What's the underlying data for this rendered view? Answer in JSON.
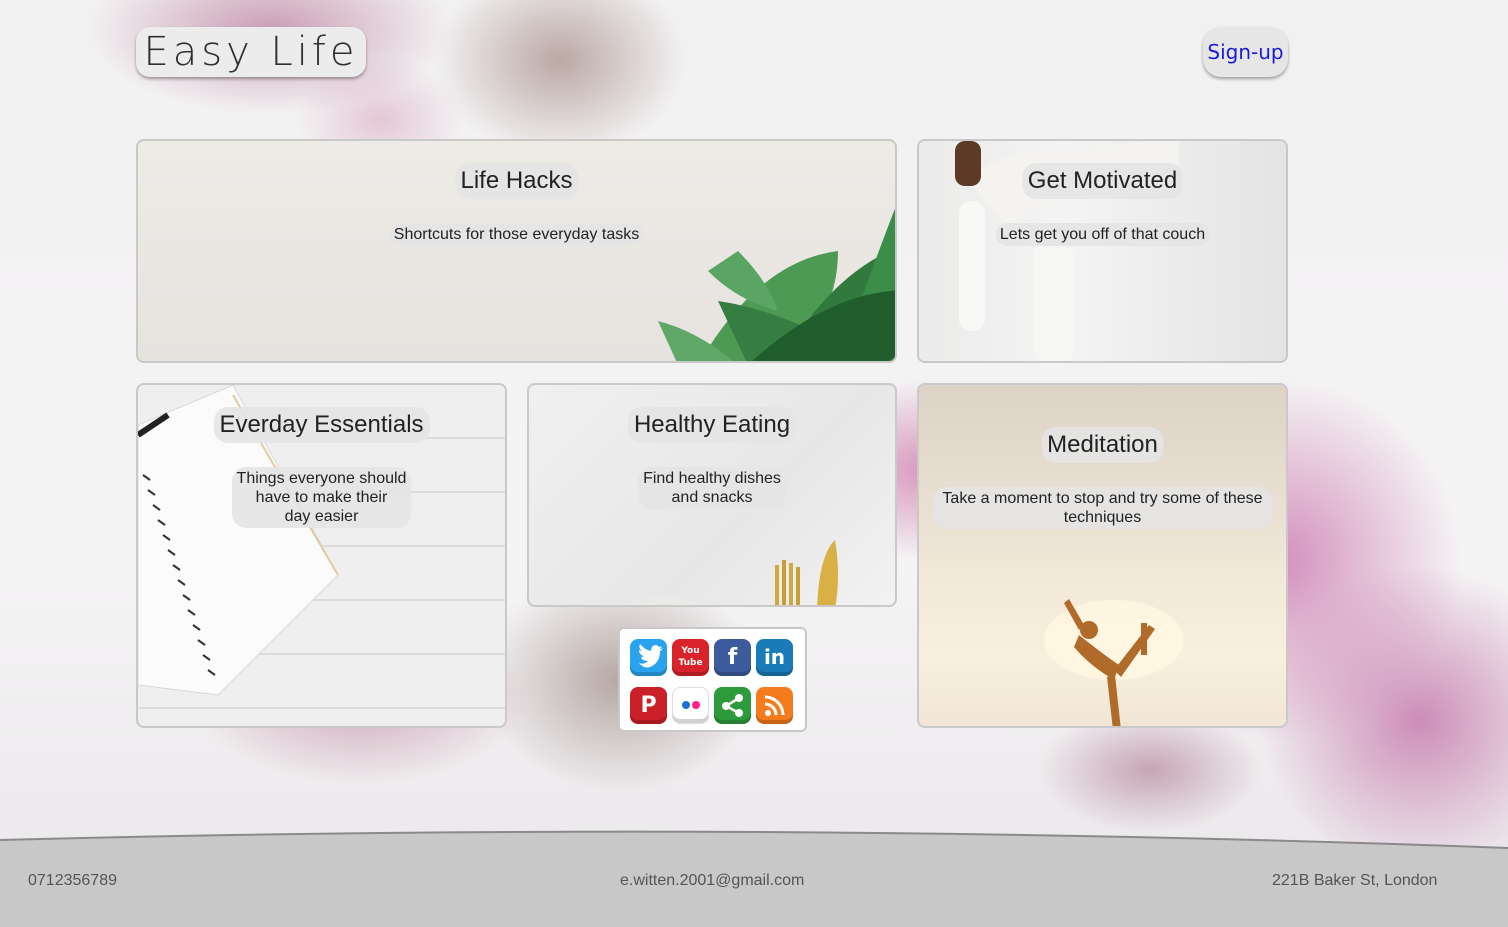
{
  "header": {
    "logo": "Easy Life",
    "signup_label": "Sign-up"
  },
  "cards": {
    "life_hacks": {
      "title": "Life Hacks",
      "desc": "Shortcuts for those everyday tasks"
    },
    "get_motivated": {
      "title": "Get Motivated",
      "desc": "Lets get you off of that couch"
    },
    "essentials": {
      "title": "Everday Essentials",
      "desc_lines": [
        "Things everyone should",
        "have to make their",
        "day easier"
      ]
    },
    "healthy_eating": {
      "title": "Healthy Eating",
      "desc_lines": [
        "Find healthy dishes",
        "and snacks"
      ]
    },
    "meditation": {
      "title": "Meditation",
      "desc_lines": [
        "Take a moment to stop and try some of these",
        "techniques"
      ]
    }
  },
  "social": {
    "icons": [
      {
        "name": "twitter-icon",
        "color": "#2aa3ef",
        "glyph": "🐦"
      },
      {
        "name": "youtube-icon",
        "color": "#d8232a",
        "glyph": "You"
      },
      {
        "name": "facebook-icon",
        "color": "#3b5b9c",
        "glyph": "f"
      },
      {
        "name": "linkedin-icon",
        "color": "#1a7bb9",
        "glyph": "in"
      },
      {
        "name": "pinterest-icon",
        "color": "#cb2027",
        "glyph": "P"
      },
      {
        "name": "flickr-icon",
        "color": "#ffffff",
        "glyph": "••"
      },
      {
        "name": "share-icon",
        "color": "#2d9b3b",
        "glyph": "<"
      },
      {
        "name": "rss-icon",
        "color": "#f57c1d",
        "glyph": ")"
      }
    ]
  },
  "footer": {
    "phone": "0712356789",
    "email": "e.witten.2001@gmail.com",
    "address": "221B Baker St, London"
  }
}
